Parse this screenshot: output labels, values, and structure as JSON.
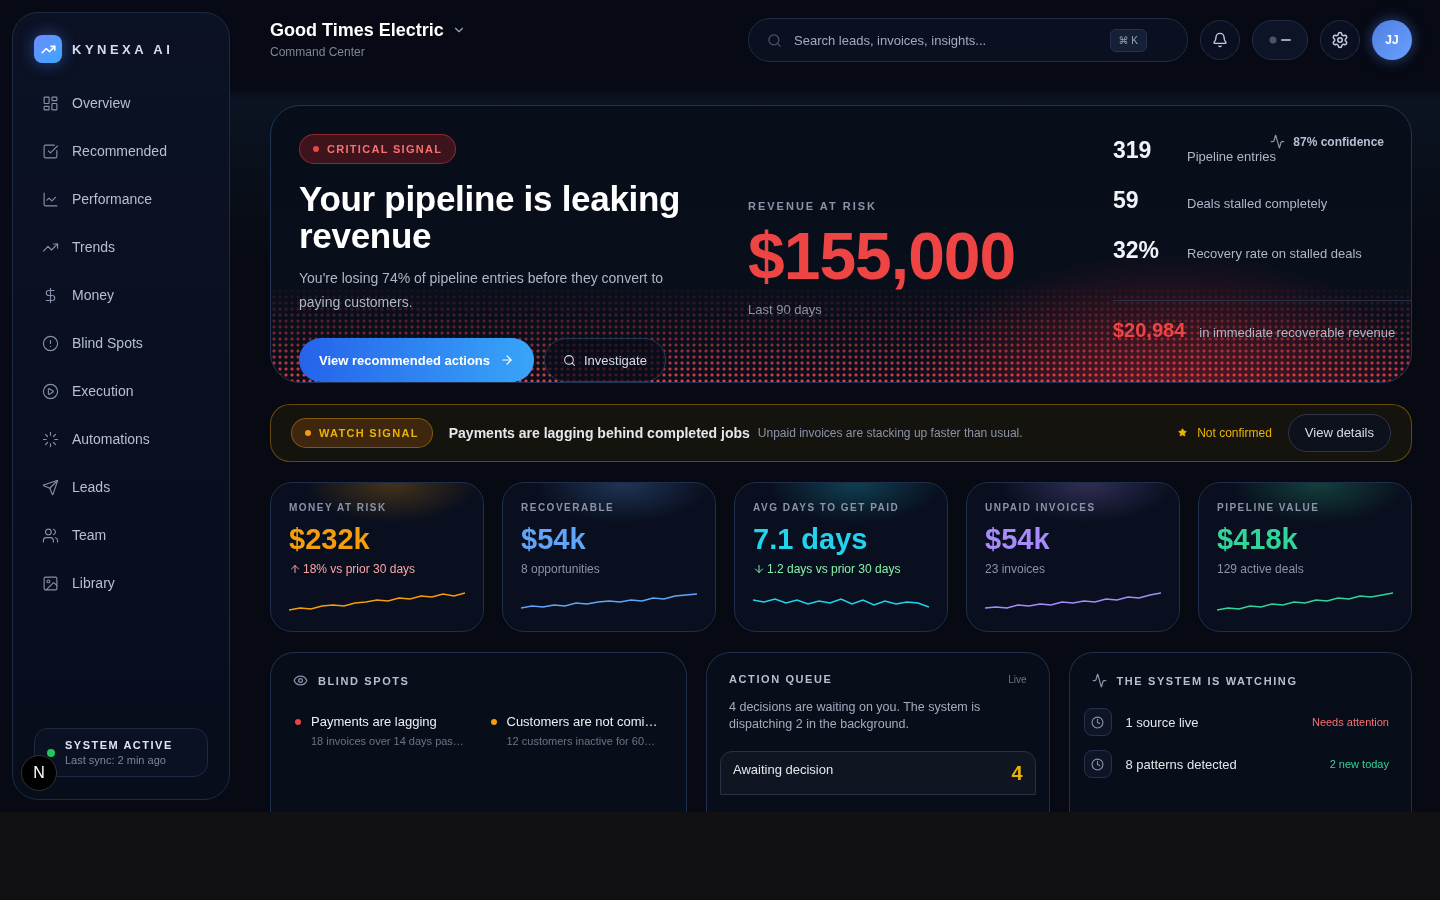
{
  "brand": {
    "name": "KYNEXA AI"
  },
  "nav": [
    {
      "label": "Overview",
      "selected": false
    },
    {
      "label": "Recommended",
      "selected": false
    },
    {
      "label": "Performance",
      "selected": false
    },
    {
      "label": "Trends",
      "selected": false
    },
    {
      "label": "Money",
      "selected": false
    },
    {
      "label": "Blind Spots",
      "selected": false
    },
    {
      "label": "Execution",
      "selected": false
    },
    {
      "label": "Automations",
      "selected": false
    },
    {
      "label": "Leads",
      "selected": false
    },
    {
      "label": "Team",
      "selected": false
    },
    {
      "label": "Library",
      "selected": false
    }
  ],
  "system_status": {
    "title": "SYSTEM ACTIVE",
    "detail": "Last sync: 2 min ago"
  },
  "dev_badge": {
    "label": "N"
  },
  "header": {
    "title": "Good Times Electric",
    "subtitle": "Command Center"
  },
  "search": {
    "placeholder": "Search leads, invoices, insights...",
    "shortcut": "⌘ K"
  },
  "avatar": {
    "initials": "JJ"
  },
  "hero": {
    "badge": "CRITICAL SIGNAL",
    "title": "Your pipeline is leaking revenue",
    "body": "You're losing 74% of pipeline entries before they convert to paying customers.",
    "primary_action": "View recommended actions",
    "secondary_action": "Investigate",
    "risk_label": "REVENUE AT RISK",
    "risk_amount": "$155,000",
    "risk_period": "Last 90 days",
    "confidence": "87% confidence",
    "stats": [
      {
        "value": "319",
        "label": "Pipeline entries"
      },
      {
        "value": "59",
        "label": "Deals stalled completely"
      },
      {
        "value": "32%",
        "label": "Recovery rate on stalled deals"
      }
    ],
    "recoverable": {
      "amount": "$20,984",
      "label": "in immediate recoverable revenue"
    }
  },
  "watch": {
    "badge": "WATCH SIGNAL",
    "title": "Payments are lagging behind completed jobs",
    "detail": "Unpaid invoices are stacking up faster than usual.",
    "status": "Not confirmed",
    "action": "View details"
  },
  "kpis": [
    {
      "label": "MONEY AT RISK",
      "value": "$232k",
      "note": "18% vs prior 30 days",
      "kind": "up",
      "color": "#f59e0b"
    },
    {
      "label": "RECOVERABLE",
      "value": "$54k",
      "note": "8 opportunities",
      "kind": "plain",
      "color": "#60a5fa"
    },
    {
      "label": "AVG DAYS TO GET PAID",
      "value": "7.1 days",
      "note": "1.2 days vs prior 30 days",
      "kind": "down",
      "color": "#22d3ee"
    },
    {
      "label": "UNPAID INVOICES",
      "value": "$54k",
      "note": "23 invoices",
      "kind": "plain",
      "color": "#a78bfa"
    },
    {
      "label": "PIPELINE VALUE",
      "value": "$418k",
      "note": "129 active deals",
      "kind": "plain",
      "color": "#34d399"
    }
  ],
  "blind_spots": {
    "title": "BLIND SPOTS",
    "items": [
      {
        "title": "Payments are lagging",
        "detail": "18 invoices over 14 days pas…",
        "color": "#ef4444"
      },
      {
        "title": "Customers are not comi…",
        "detail": "12 customers inactive for 60…",
        "color": "#f59e0b"
      }
    ]
  },
  "action_queue": {
    "title": "ACTION QUEUE",
    "live": "Live",
    "body": "4 decisions are waiting on you. The system is dispatching 2 in the background.",
    "items": [
      {
        "label": "Awaiting decision",
        "count": "4"
      }
    ]
  },
  "watching": {
    "title": "THE SYSTEM IS WATCHING",
    "rows": [
      {
        "label": "1 source live",
        "status": "Needs attention",
        "kind": "alert"
      },
      {
        "label": "8 patterns detected",
        "status": "2 new today",
        "kind": "ok"
      }
    ]
  }
}
